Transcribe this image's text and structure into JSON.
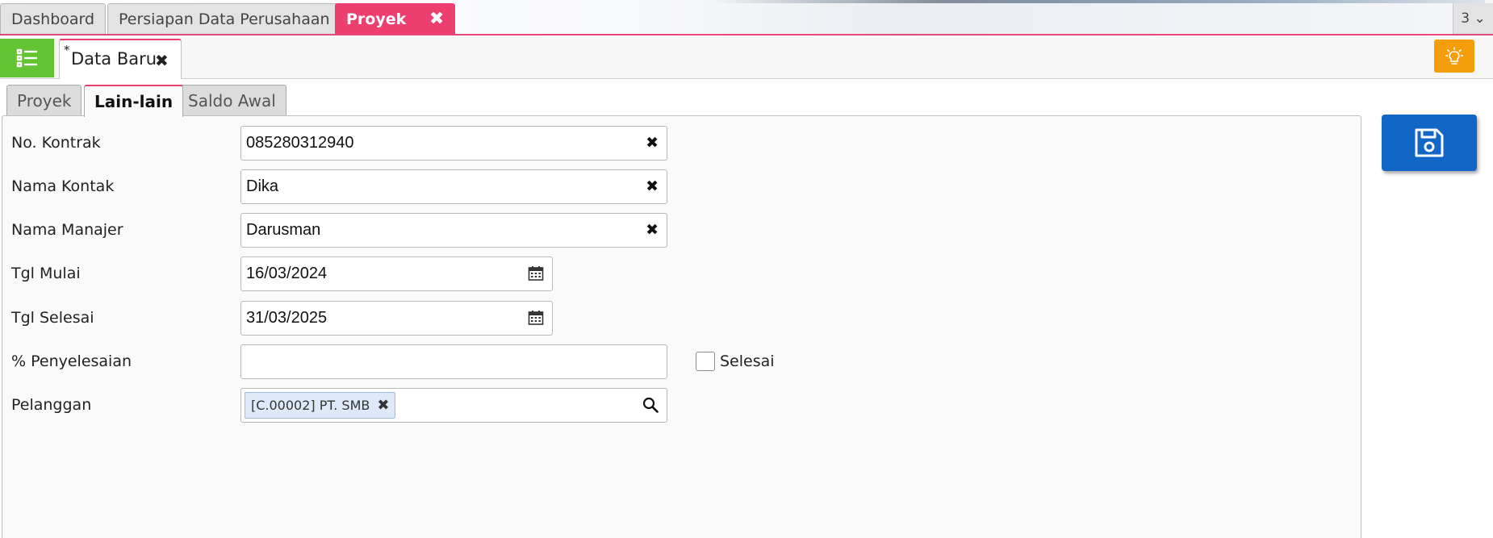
{
  "window_tabs": [
    {
      "label": "Dashboard"
    },
    {
      "label": "Persiapan Data Perusahaan"
    },
    {
      "label": "Proyek",
      "close": "✖"
    }
  ],
  "tab_count": {
    "label": "3",
    "chevron": "⌄"
  },
  "document_tab": {
    "modified_mark": "*",
    "title": "Data Baru",
    "close": "✖"
  },
  "section_tabs": [
    {
      "label": "Proyek"
    },
    {
      "label": "Lain-lain"
    },
    {
      "label": "Saldo Awal"
    }
  ],
  "form": {
    "no_kontrak": {
      "label": "No. Kontrak",
      "value": "085280312940",
      "clear": "✖"
    },
    "nama_kontak": {
      "label": "Nama Kontak",
      "value": "Dika",
      "clear": "✖"
    },
    "nama_manajer": {
      "label": "Nama Manajer",
      "value": "Darusman",
      "clear": "✖"
    },
    "tgl_mulai": {
      "label": "Tgl Mulai",
      "value": "16/03/2024"
    },
    "tgl_selesai": {
      "label": "Tgl Selesai",
      "value": "31/03/2025"
    },
    "penyelesaian": {
      "label": "% Penyelesaian",
      "value": "",
      "checkbox_label": "Selesai",
      "checked": false
    },
    "pelanggan": {
      "label": "Pelanggan",
      "chip": "[C.00002] PT. SMB",
      "chip_remove": "✖"
    }
  },
  "icons": {
    "menu": "list-icon",
    "tips": "lightbulb-icon",
    "calendar": "calendar-icon",
    "search": "search-icon",
    "save": "floppy-disk-icon"
  },
  "colors": {
    "accent_pink": "#ec3f70",
    "menu_green": "#62c431",
    "tips_orange": "#f59e0b",
    "save_blue": "#1166c6",
    "chip_bg": "#dde9f8"
  }
}
